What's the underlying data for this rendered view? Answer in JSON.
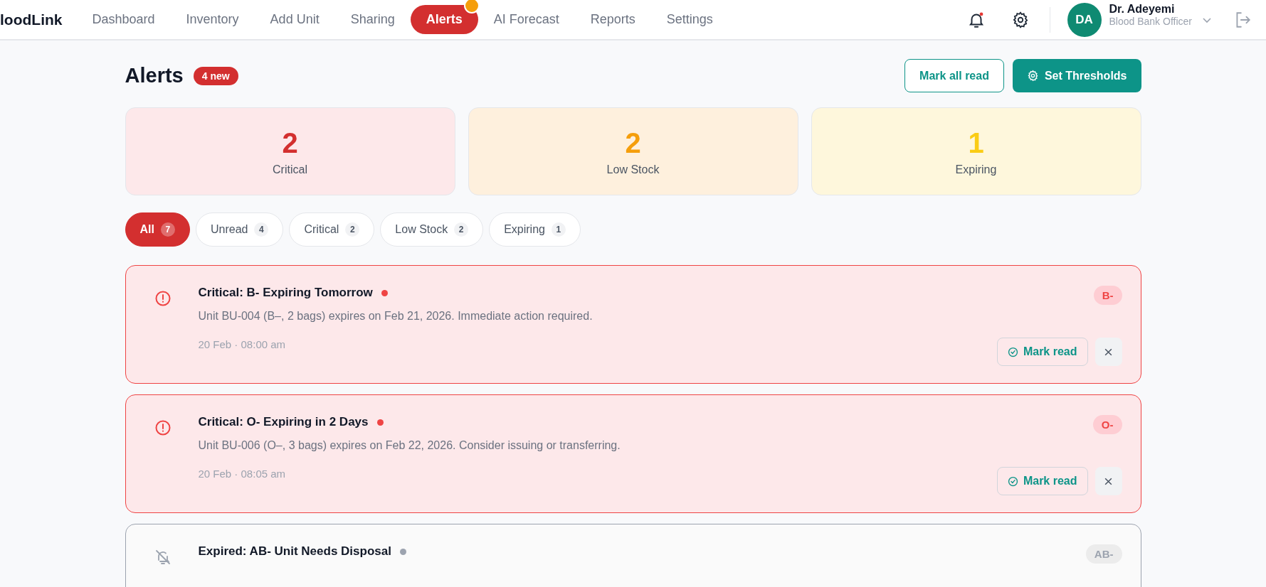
{
  "nav": {
    "logo": "loodLink",
    "items": [
      {
        "label": "Dashboard",
        "selected": false,
        "badge": false
      },
      {
        "label": "Inventory",
        "selected": false,
        "badge": false
      },
      {
        "label": "Add Unit",
        "selected": false,
        "badge": false
      },
      {
        "label": "Sharing",
        "selected": false,
        "badge": false
      },
      {
        "label": "Alerts",
        "selected": true,
        "badge": true
      },
      {
        "label": "AI Forecast",
        "selected": false,
        "badge": false
      },
      {
        "label": "Reports",
        "selected": false,
        "badge": false
      },
      {
        "label": "Settings",
        "selected": false,
        "badge": false
      }
    ],
    "notifications_unread": true,
    "user": {
      "initials": "DA",
      "name": "Dr. Adeyemi",
      "role": "Blood Bank Officer"
    }
  },
  "header": {
    "title": "Alerts",
    "new_badge": "4 new",
    "buttons": [
      {
        "kind": "outline",
        "label": "Mark all read"
      },
      {
        "kind": "primary",
        "label": "Set Thresholds"
      }
    ]
  },
  "stats": [
    {
      "kind": "critical",
      "value": "2",
      "label": "Critical"
    },
    {
      "kind": "low",
      "value": "2",
      "label": "Low Stock"
    },
    {
      "kind": "expiring",
      "value": "1",
      "label": "Expiring"
    }
  ],
  "filters": [
    {
      "label": "All",
      "count": "7",
      "selected": true
    },
    {
      "label": "Unread",
      "count": "4",
      "selected": false
    },
    {
      "label": "Critical",
      "count": "2",
      "selected": false
    },
    {
      "label": "Low Stock",
      "count": "2",
      "selected": false
    },
    {
      "label": "Expiring",
      "count": "1",
      "selected": false
    }
  ],
  "alerts": [
    {
      "kind": "critical",
      "read": false,
      "title": "Critical: B- Expiring Tomorrow",
      "tag": "B-",
      "text": "Unit BU-004 (B–, 2 bags) expires on Feb 21, 2026. Immediate action required.",
      "time": "20 Feb · 08:00 am",
      "action": "Mark read"
    },
    {
      "kind": "critical",
      "read": false,
      "title": "Critical: O- Expiring in 2 Days",
      "tag": "O-",
      "text": "Unit BU-006 (O–, 3 bags) expires on Feb 22, 2026. Consider issuing or transferring.",
      "time": "20 Feb · 08:05 am",
      "action": "Mark read"
    },
    {
      "kind": "expired",
      "read": true,
      "title": "Expired: AB- Unit Needs Disposal",
      "tag": "AB-"
    }
  ]
}
